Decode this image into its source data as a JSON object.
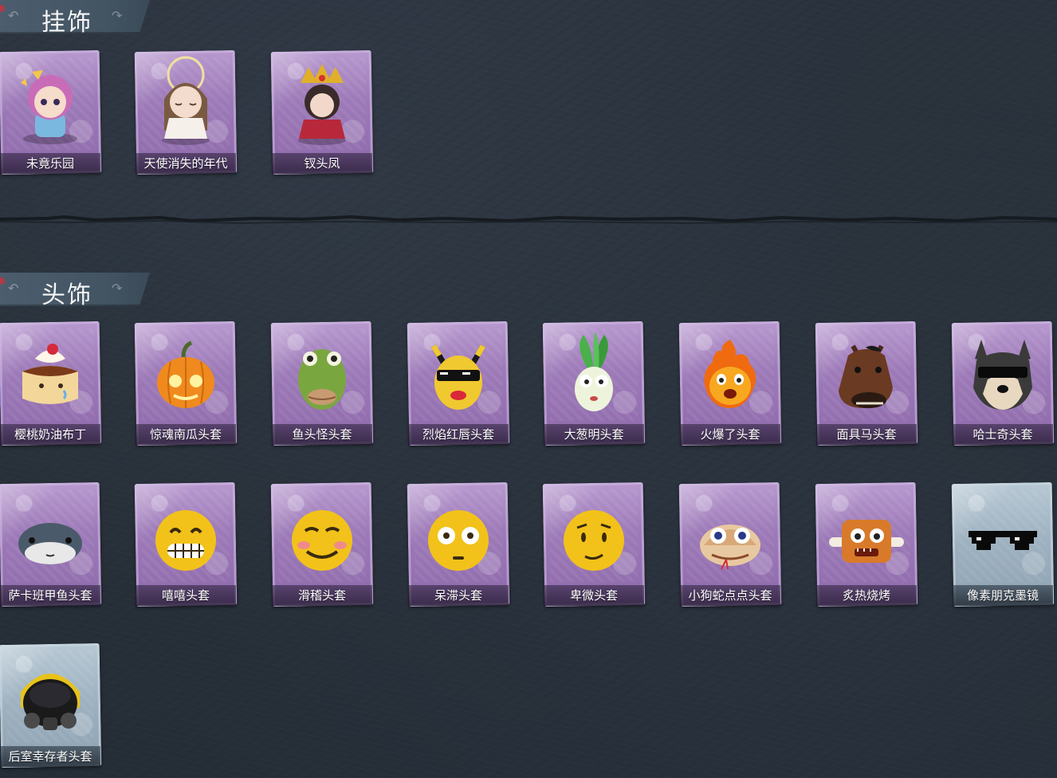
{
  "sections": {
    "pendants": {
      "title": "挂饰"
    },
    "headwear": {
      "title": "头饰"
    }
  },
  "pendant_items": [
    {
      "name": "未竟乐园",
      "frame": "purple",
      "icon": "chibi-girl-purple-hair-icon"
    },
    {
      "name": "天使消失的年代",
      "frame": "purple",
      "icon": "chibi-angel-girl-icon"
    },
    {
      "name": "钗头凤",
      "frame": "purple",
      "icon": "chibi-phoenix-crown-girl-icon"
    }
  ],
  "headwear_items": [
    {
      "name": "樱桃奶油布丁",
      "frame": "purple",
      "icon": "pudding-head-icon"
    },
    {
      "name": "惊魂南瓜头套",
      "frame": "purple",
      "icon": "pumpkin-head-icon"
    },
    {
      "name": "鱼头怪头套",
      "frame": "purple",
      "icon": "fish-head-icon"
    },
    {
      "name": "烈焰红唇头套",
      "frame": "purple",
      "icon": "yellow-mask-sunglasses-icon"
    },
    {
      "name": "大葱明头套",
      "frame": "purple",
      "icon": "scallion-head-icon"
    },
    {
      "name": "火爆了头套",
      "frame": "purple",
      "icon": "fire-head-icon"
    },
    {
      "name": "面具马头套",
      "frame": "purple",
      "icon": "horse-head-icon"
    },
    {
      "name": "哈士奇头套",
      "frame": "purple",
      "icon": "husky-sunglasses-icon"
    },
    {
      "name": "萨卡班甲鱼头套",
      "frame": "purple",
      "icon": "sacabambaspis-head-icon"
    },
    {
      "name": "嘻嘻头套",
      "frame": "purple",
      "icon": "grinning-emoji-head-icon"
    },
    {
      "name": "滑稽头套",
      "frame": "purple",
      "icon": "funny-emoji-head-icon"
    },
    {
      "name": "呆滞头套",
      "frame": "purple",
      "icon": "dazed-emoji-head-icon"
    },
    {
      "name": "卑微头套",
      "frame": "purple",
      "icon": "humble-emoji-head-icon"
    },
    {
      "name": "小狗蛇点点头套",
      "frame": "purple",
      "icon": "snake-head-icon"
    },
    {
      "name": "炙热烧烤",
      "frame": "purple",
      "icon": "bbq-meat-head-icon"
    },
    {
      "name": "像素朋克墨镜",
      "frame": "blue",
      "icon": "pixel-sunglasses-icon"
    },
    {
      "name": "后室幸存者头套",
      "frame": "blue",
      "icon": "gas-mask-helmet-icon"
    }
  ],
  "colors": {
    "background": "#283039",
    "purple_frame": "#9d7ab8",
    "blue_frame": "#9fb2c1",
    "header": "#4c5d6d"
  }
}
